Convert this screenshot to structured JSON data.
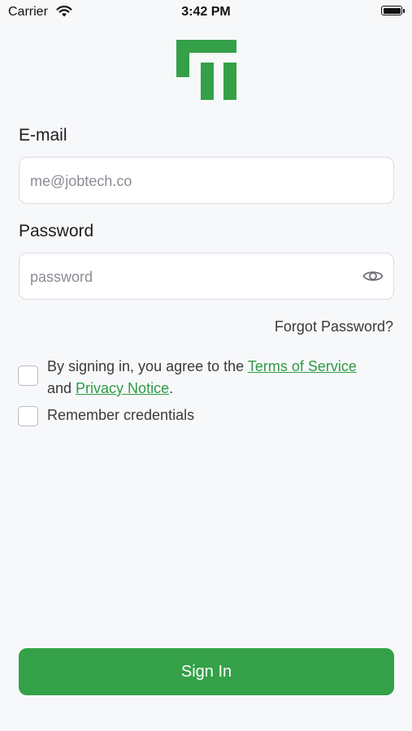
{
  "status_bar": {
    "carrier": "Carrier",
    "time": "3:42 PM"
  },
  "logo": {
    "name": "jobtech-logo",
    "color": "#34a048"
  },
  "email": {
    "label": "E-mail",
    "placeholder": "me@jobtech.co",
    "value": ""
  },
  "password": {
    "label": "Password",
    "placeholder": "password",
    "value": "",
    "toggle_icon": "eye-icon"
  },
  "forgot_password": "Forgot Password?",
  "consent": {
    "prefix": "By signing in, you agree to the ",
    "terms_link": "Terms of Service",
    "and": "and ",
    "privacy_link": "Privacy Notice",
    "suffix": ".",
    "checked": false
  },
  "remember": {
    "label": "Remember credentials",
    "checked": false
  },
  "signin_button": "Sign In",
  "colors": {
    "accent": "#34a048",
    "link": "#2e9b45",
    "background": "#f7f8fa"
  }
}
